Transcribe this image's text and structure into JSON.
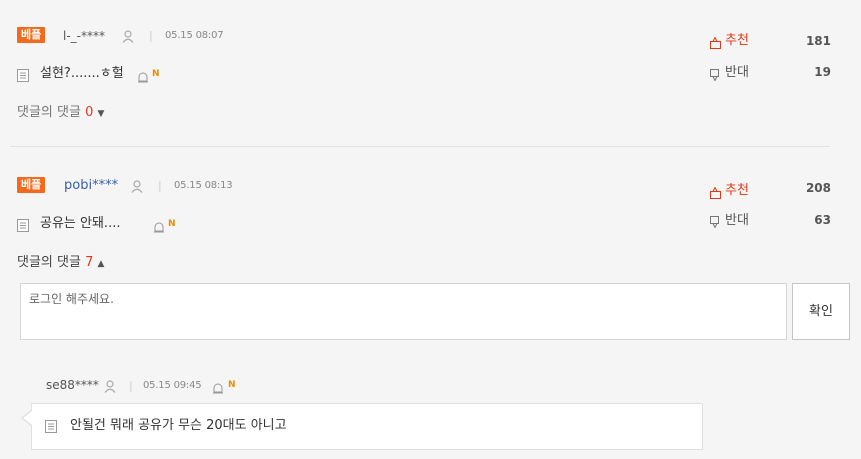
{
  "comments": [
    {
      "badge": "베플",
      "author": "l-_-****",
      "separator": "|",
      "time": "05.15 08:07",
      "text": "설현?.......ㅎ헐",
      "new_marker": "N",
      "up_label": "추천",
      "up_count": "181",
      "down_label": "반대",
      "down_count": "19",
      "reply_label": "댓글의 댓글",
      "reply_count": "0",
      "reply_arrow": "▼"
    },
    {
      "badge": "베플",
      "author": "pobi****",
      "separator": "|",
      "time": "05.15 08:13",
      "text": "공유는 안돼....",
      "new_marker": "N",
      "up_label": "추천",
      "up_count": "208",
      "down_label": "반대",
      "down_count": "63",
      "reply_label": "댓글의 댓글",
      "reply_count": "7",
      "reply_arrow": "▲",
      "reply_input_placeholder": "로그인 해주세요.",
      "confirm_label": "확인"
    }
  ],
  "reply": {
    "author": "se88****",
    "separator": "|",
    "time": "05.15 09:45",
    "new_marker": "N",
    "text": "안될건 뭐래 공유가 무슨 20대도 아니고"
  },
  "colors": {
    "badge": "#f36a1f",
    "author": "#3a5ea8",
    "upvote": "#e03a1a",
    "background": "#f5f5f5"
  }
}
